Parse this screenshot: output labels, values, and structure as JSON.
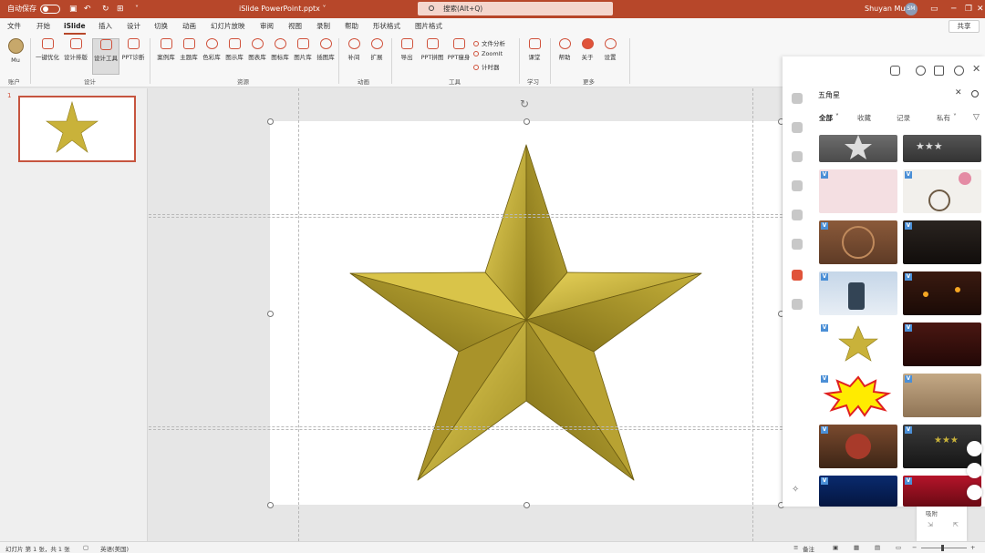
{
  "title_bar": {
    "autosave_label": "自动保存",
    "file_name": "iSlide PowerPoint.pptx ˅",
    "search_placeholder": "搜索(Alt+Q)",
    "user_name": "Shuyan Mu",
    "user_initials": "SM",
    "accent_color": "#b7472a"
  },
  "menu_tabs": [
    "文件",
    "开始",
    "iSlide",
    "插入",
    "设计",
    "切换",
    "动画",
    "幻灯片放映",
    "审阅",
    "视图",
    "录制",
    "帮助",
    "形状格式",
    "图片格式"
  ],
  "active_tab": "iSlide",
  "share_label": "共享",
  "ribbon": {
    "account": {
      "label": "Mu",
      "group": "账户"
    },
    "design_buttons": [
      "一键优化",
      "设计排版",
      "设计工具",
      "PPT诊断"
    ],
    "design_group": "设计",
    "resource_buttons": [
      "案例库",
      "主题库",
      "色彩库",
      "图示库",
      "图表库",
      "图标库",
      "图片库",
      "插图库"
    ],
    "resource_group": "资源",
    "animation_buttons": [
      "补间",
      "扩展"
    ],
    "animation_group": "动画",
    "tool_buttons": [
      "导出",
      "PPT拼图",
      "PPT瘦身"
    ],
    "tool_small": [
      "文件分析",
      "ZoomIt",
      "计时器"
    ],
    "tool_group": "工具",
    "learn_buttons": [
      "课堂"
    ],
    "learn_group": "学习",
    "more_buttons": [
      "帮助",
      "关于",
      "设置"
    ],
    "more_group": "更多"
  },
  "slide_panel": {
    "slide_number": "1"
  },
  "side_panel": {
    "search_value": "五角星",
    "tabs": [
      "全部",
      "收藏",
      "记录",
      "私有"
    ],
    "active_tab": "全部",
    "bottom_label": "吸附"
  },
  "status_bar": {
    "slide_info": "幻灯片 第 1 张，共 1 张",
    "language": "英语(美国)",
    "notes": "备注"
  }
}
